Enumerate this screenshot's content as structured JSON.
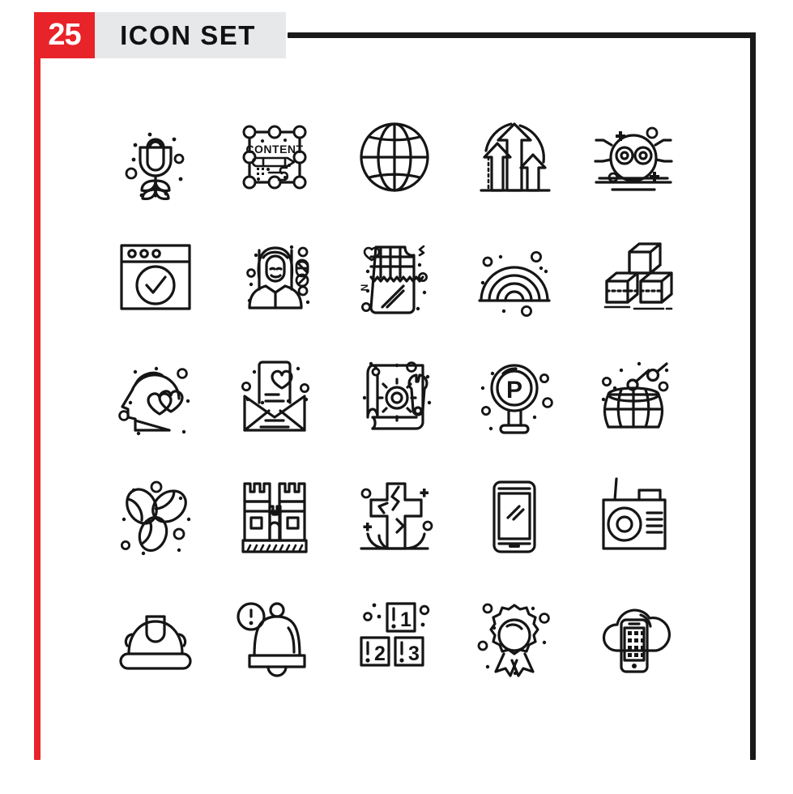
{
  "poster": {
    "count_badge": "25",
    "title": "ICON SET",
    "accent_color": "#e8232a",
    "band_color": "#e7e8ea",
    "frame_color": "#1a1a1a",
    "stroke_color": "#151515",
    "background_color": "#ffffff",
    "columns": 5,
    "rows": 5,
    "total_icons": 25
  },
  "icons": [
    {
      "index": 1,
      "name": "rose-flower-icon",
      "label": "Rose"
    },
    {
      "index": 2,
      "name": "content-editing-icon",
      "label": "Content",
      "glyph_text": "CONTENT"
    },
    {
      "index": 3,
      "name": "globe-grid-icon",
      "label": "Globe"
    },
    {
      "index": 4,
      "name": "growth-arrows-icon",
      "label": "Growth Arrows"
    },
    {
      "index": 5,
      "name": "bug-spider-icon",
      "label": "Bug"
    },
    {
      "index": 6,
      "name": "browser-check-icon",
      "label": "Browser Approved"
    },
    {
      "index": 7,
      "name": "female-pharmacist-icon",
      "label": "Pharmacist"
    },
    {
      "index": 8,
      "name": "chocolate-bar-icon",
      "label": "Chocolate"
    },
    {
      "index": 9,
      "name": "rainbow-icon",
      "label": "Rainbow"
    },
    {
      "index": 10,
      "name": "stacked-cubes-icon",
      "label": "Cubes"
    },
    {
      "index": 11,
      "name": "head-hearts-icon",
      "label": "Love Mind"
    },
    {
      "index": 12,
      "name": "love-letter-icon",
      "label": "Love Letter"
    },
    {
      "index": 13,
      "name": "blueprint-tools-icon",
      "label": "Blueprint"
    },
    {
      "index": 14,
      "name": "parking-sign-icon",
      "label": "Parking",
      "glyph_text": "P"
    },
    {
      "index": 15,
      "name": "drum-icon",
      "label": "Drum"
    },
    {
      "index": 16,
      "name": "coffee-beans-icon",
      "label": "Coffee Beans"
    },
    {
      "index": 17,
      "name": "sandcastle-icon",
      "label": "Sandcastle"
    },
    {
      "index": 18,
      "name": "grave-cross-icon",
      "label": "Grave"
    },
    {
      "index": 19,
      "name": "smartphone-icon",
      "label": "Smartphone"
    },
    {
      "index": 20,
      "name": "radio-icon",
      "label": "Radio"
    },
    {
      "index": 21,
      "name": "safety-helmet-icon",
      "label": "Helmet"
    },
    {
      "index": 22,
      "name": "alert-bell-icon",
      "label": "Alert Bell"
    },
    {
      "index": 23,
      "name": "number-blocks-icon",
      "label": "Number Blocks",
      "glyph_text": "1 2 3"
    },
    {
      "index": 24,
      "name": "award-ribbon-icon",
      "label": "Award"
    },
    {
      "index": 25,
      "name": "cloud-mobile-icon",
      "label": "Cloud Mobile"
    }
  ]
}
